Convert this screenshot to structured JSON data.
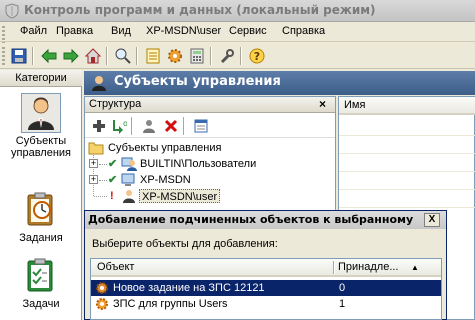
{
  "window": {
    "title": "Контроль программ и данных (локальный режим)"
  },
  "menu": [
    "Файл",
    "Правка",
    "Вид",
    "XP-MSDN\\user",
    "Сервис",
    "Справка"
  ],
  "categories": {
    "header": "Категории",
    "items": [
      {
        "label": "Субъекты управления",
        "icon": "user-agent-icon",
        "selected": true
      },
      {
        "label": "Задания",
        "icon": "calendar-clipboard-icon",
        "selected": false
      },
      {
        "label": "Задачи",
        "icon": "tasks-clipboard-icon",
        "selected": false
      }
    ]
  },
  "section": {
    "title": "Субъекты управления"
  },
  "structure": {
    "header": "Структура",
    "close": "×",
    "root": "Субъекты управления",
    "nodes": [
      {
        "label": "BUILTIN\\Пользователи",
        "status": "check"
      },
      {
        "label": "XP-MSDN",
        "status": "check"
      },
      {
        "label": "XP-MSDN\\user",
        "status": "warning"
      }
    ]
  },
  "name_panel": {
    "column": "Имя"
  },
  "dialog": {
    "title": "Добавление подчиненных объектов к выбранному",
    "close": "X",
    "prompt": "Выберите объекты для добавления:",
    "columns": {
      "object": "Объект",
      "belongs": "Принадле..."
    },
    "sort_indicator": "▲",
    "rows": [
      {
        "object": "Новое задание на ЗПС 12121",
        "belongs": "0",
        "selected": true
      },
      {
        "object": "ЗПС для группы Users",
        "belongs": "1",
        "selected": false
      }
    ]
  },
  "colors": {
    "accent": "#0a246a",
    "header_blue": "#4a6b96",
    "window_bg": "#ece9d8"
  }
}
